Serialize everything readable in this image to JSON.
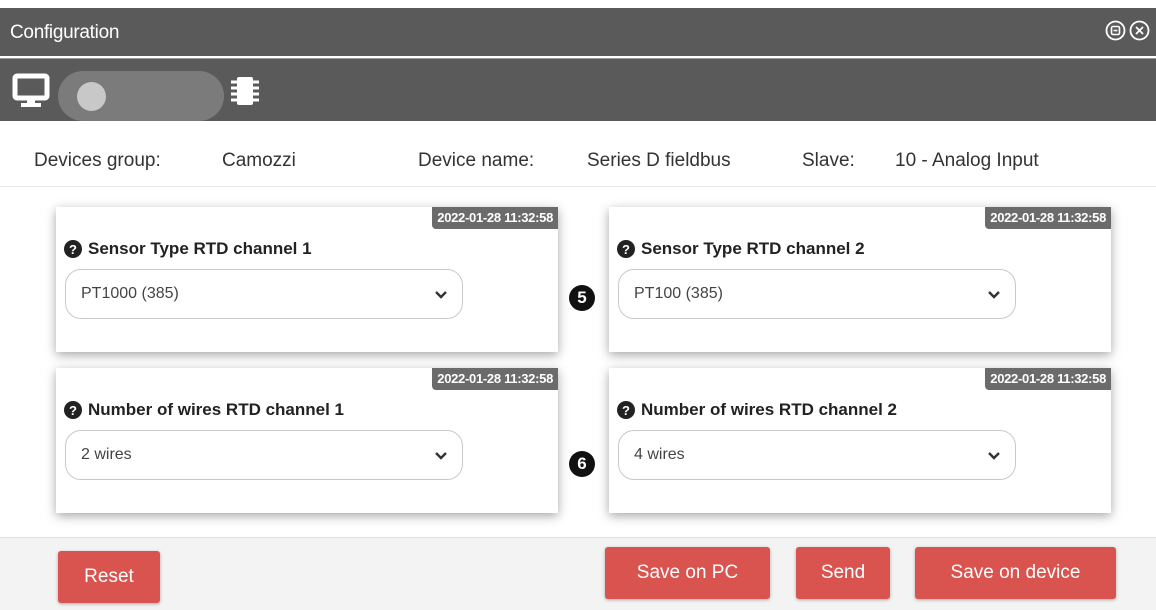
{
  "window": {
    "title": "Configuration"
  },
  "icons": {
    "title_buttons": [
      "minimize-icon",
      "close-icon"
    ],
    "toolbar": [
      "monitor-icon",
      "chip-icon"
    ],
    "help": "question-circle-icon",
    "select_arrow": "chevron-down-icon"
  },
  "info": {
    "group_label": "Devices group:",
    "group_value": "Camozzi",
    "device_label": "Device name:",
    "device_value": "Series D fieldbus",
    "slave_label": "Slave:",
    "slave_value": "10 - Analog Input"
  },
  "cards": [
    {
      "timestamp": "2022-01-28 11:32:58",
      "label": "Sensor Type RTD channel 1",
      "value": "PT1000 (385)"
    },
    {
      "timestamp": "2022-01-28 11:32:58",
      "label": "Sensor Type RTD channel 2",
      "value": "PT100 (385)"
    },
    {
      "timestamp": "2022-01-28 11:32:58",
      "label": "Number of wires RTD channel 1",
      "value": "2 wires"
    },
    {
      "timestamp": "2022-01-28 11:32:58",
      "label": "Number of wires RTD channel 2",
      "value": "4 wires"
    }
  ],
  "markers": [
    "5",
    "6"
  ],
  "buttons": {
    "reset": "Reset",
    "save_pc": "Save on PC",
    "send": "Send",
    "save_device": "Save on device"
  },
  "colors": {
    "titlebar": "#5a5a5a",
    "button": "#d9534f",
    "timestamp_badge": "#6b6b6b"
  }
}
